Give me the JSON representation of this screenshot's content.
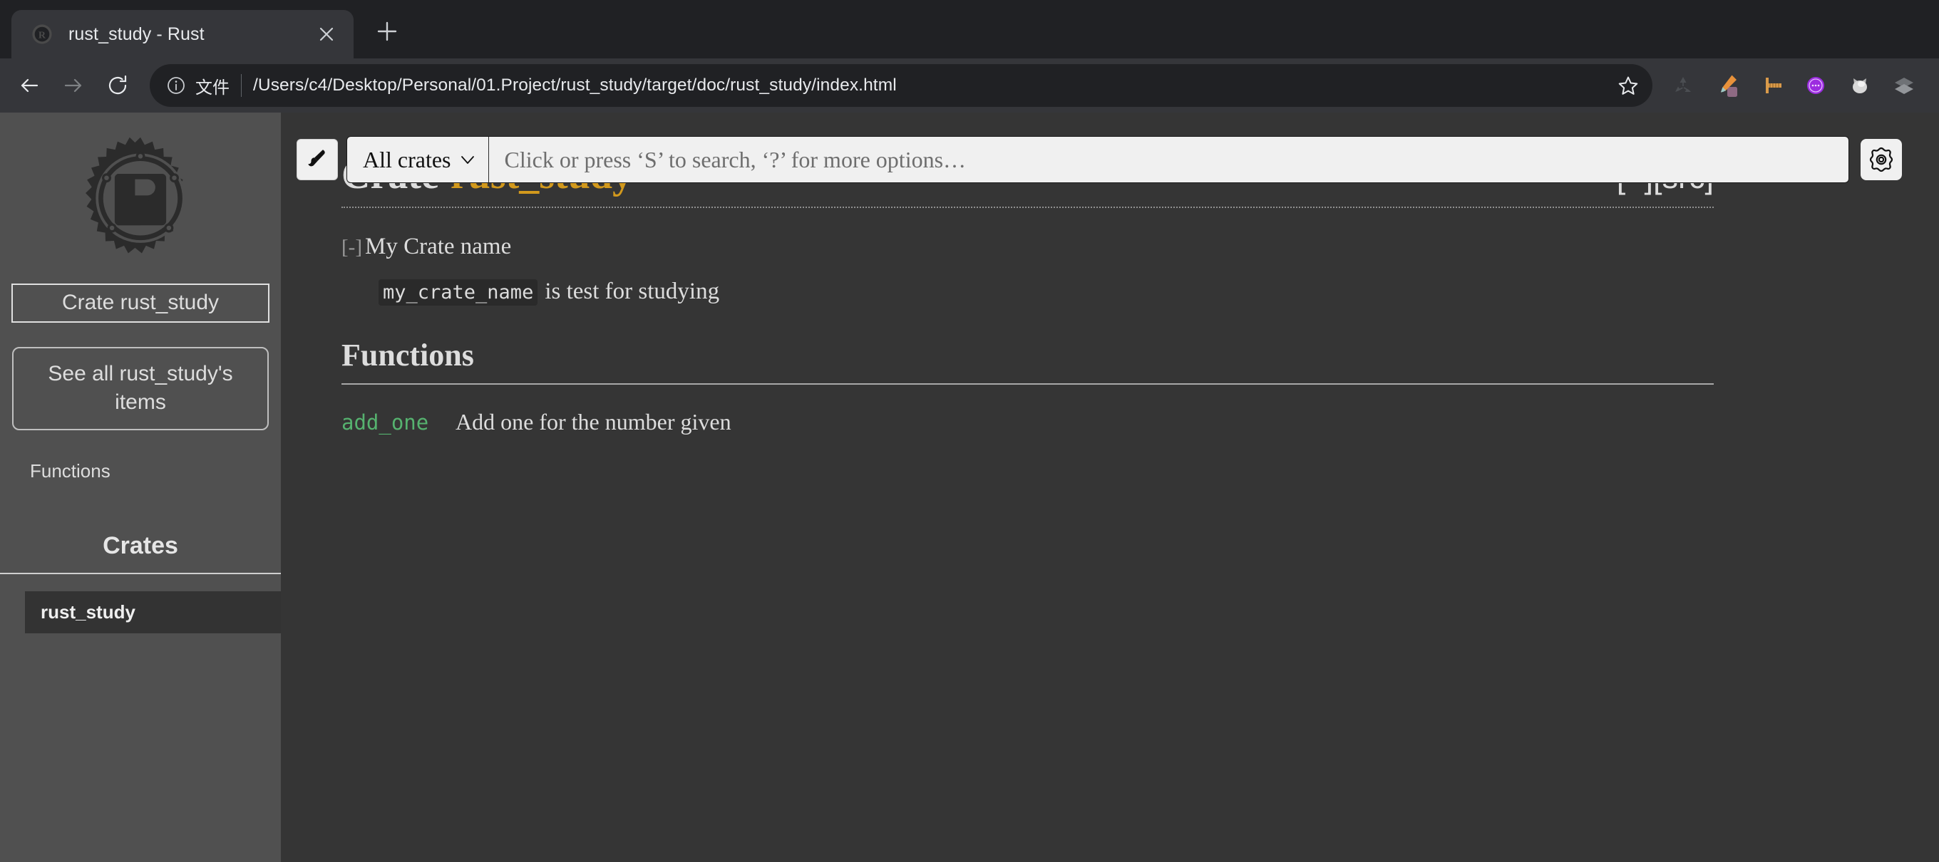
{
  "browser": {
    "tab": {
      "title": "rust_study - Rust",
      "favicon_icon": "rust-logo-icon",
      "close_icon": "close-icon"
    },
    "new_tab_icon": "plus-icon",
    "nav": {
      "back_icon": "arrow-left-icon",
      "forward_icon": "arrow-right-icon",
      "reload_icon": "reload-icon"
    },
    "omnibox": {
      "info_icon": "info-circle-icon",
      "scheme_label": "文件",
      "url": "/Users/c4/Desktop/Personal/01.Project/rust_study/target/doc/rust_study/index.html",
      "star_icon": "star-outline-icon"
    },
    "extensions": [
      {
        "name": "recycle-extension-icon"
      },
      {
        "name": "eyedropper-extension-icon"
      },
      {
        "name": "ruler-extension-icon"
      },
      {
        "name": "purple-circle-extension-icon"
      },
      {
        "name": "cat-extension-icon"
      },
      {
        "name": "layers-extension-icon"
      }
    ]
  },
  "search": {
    "theme_icon": "paintbrush-icon",
    "crate_filter_value": "All crates",
    "chevron_icon": "chevron-down-icon",
    "placeholder": "Click or press ‘S’ to search, ‘?’ for more options…",
    "settings_icon": "gear-icon"
  },
  "sidebar": {
    "logo_icon": "rust-gear-logo-icon",
    "crate_title": "Crate rust_study",
    "see_all_label": "See all rust_study's items",
    "links": [
      {
        "label": "Functions"
      }
    ],
    "crates_heading": "Crates",
    "crates": [
      {
        "label": "rust_study",
        "current": true
      }
    ]
  },
  "main": {
    "heading": {
      "prefix": "Crate",
      "name": "rust_study",
      "links": "[−][src]",
      "name_color": "#d2991d"
    },
    "docblock": {
      "collapse_toggle": "[-]",
      "heading": "My Crate name",
      "code": "my_crate_name",
      "text": "is test for studying"
    },
    "functions_section": {
      "title": "Functions",
      "items": [
        {
          "name": "add_one",
          "desc": "Add one for the number given"
        }
      ]
    }
  }
}
